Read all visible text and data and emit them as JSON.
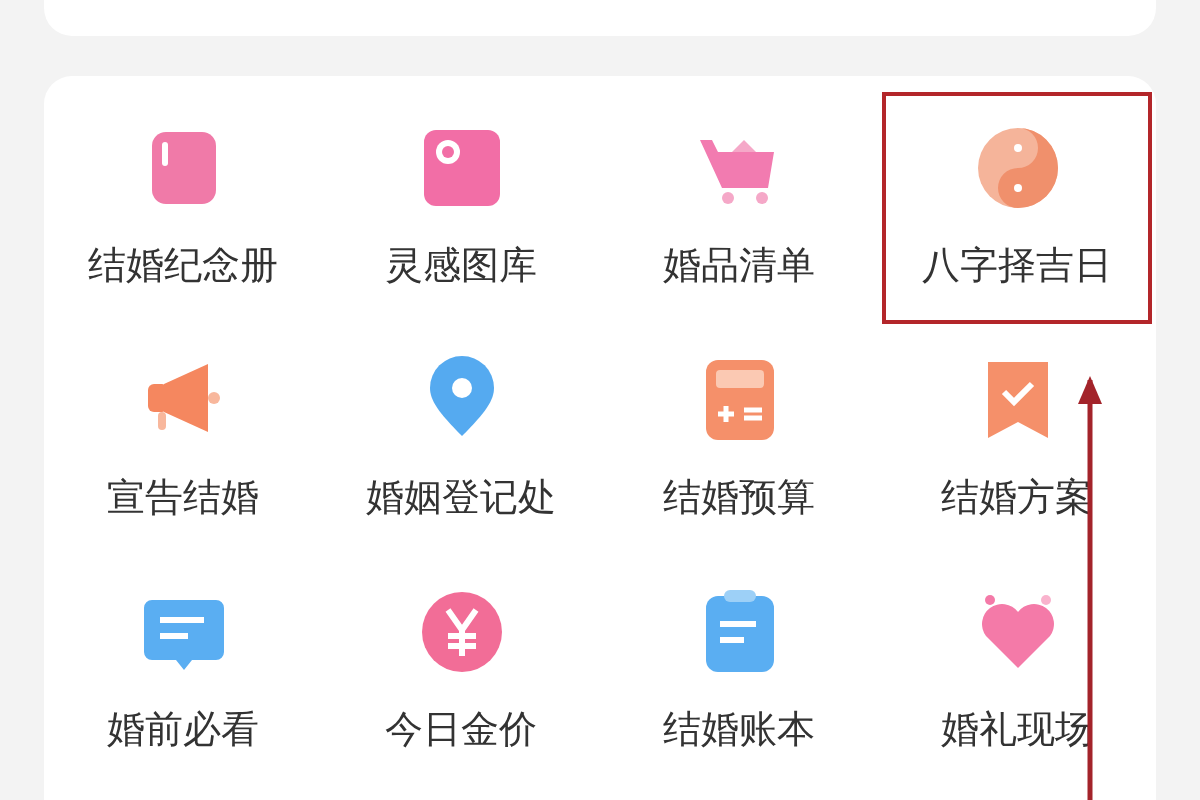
{
  "features": [
    {
      "label": "结婚纪念册",
      "kind": "notebook",
      "highlighted": false
    },
    {
      "label": "灵感图库",
      "kind": "photo",
      "highlighted": false
    },
    {
      "label": "婚品清单",
      "kind": "cart",
      "highlighted": false
    },
    {
      "label": "八字择吉日",
      "kind": "yinyang",
      "highlighted": true
    },
    {
      "label": "宣告结婚",
      "kind": "megaphone",
      "highlighted": false
    },
    {
      "label": "婚姻登记处",
      "kind": "pin",
      "highlighted": false
    },
    {
      "label": "结婚预算",
      "kind": "calculator",
      "highlighted": false
    },
    {
      "label": "结婚方案",
      "kind": "ribbon",
      "highlighted": false
    },
    {
      "label": "婚前必看",
      "kind": "chat",
      "highlighted": false
    },
    {
      "label": "今日金价",
      "kind": "yen",
      "highlighted": false
    },
    {
      "label": "结婚账本",
      "kind": "clipboard",
      "highlighted": false
    },
    {
      "label": "婚礼现场",
      "kind": "heart",
      "highlighted": false
    }
  ],
  "annotation": {
    "arrow": true
  }
}
